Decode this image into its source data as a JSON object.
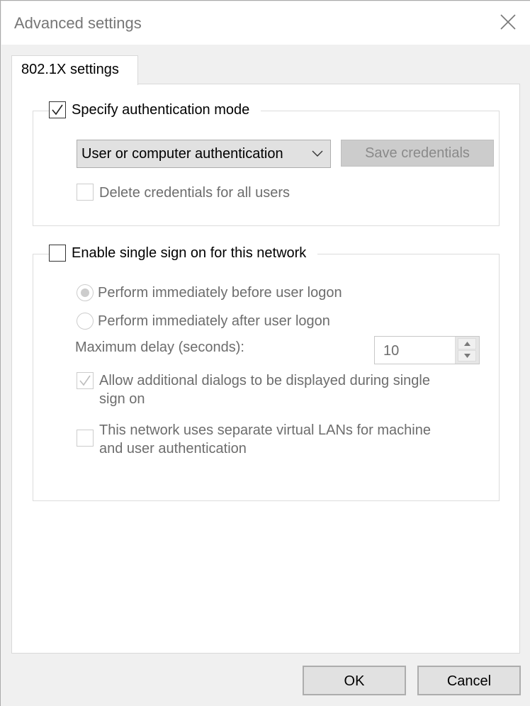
{
  "window": {
    "title": "Advanced settings",
    "close_icon": "close-icon"
  },
  "tabs": [
    {
      "label": "802.1X settings",
      "active": true
    }
  ],
  "auth_group": {
    "specify_mode": {
      "label": "Specify authentication mode",
      "checked": true
    },
    "mode_select": {
      "value": "User or computer authentication",
      "icon": "chevron-down-icon"
    },
    "save_credentials": {
      "label": "Save credentials",
      "enabled": false
    },
    "delete_credentials": {
      "label": "Delete credentials for all users",
      "checked": false,
      "enabled": false
    }
  },
  "sso_group": {
    "enable_sso": {
      "label": "Enable single sign on for this network",
      "checked": false
    },
    "radio_before": {
      "label": "Perform immediately before user logon",
      "selected": true,
      "enabled": false
    },
    "radio_after": {
      "label": "Perform immediately after user logon",
      "selected": false,
      "enabled": false
    },
    "max_delay": {
      "label": "Maximum delay (seconds):",
      "value": "10"
    },
    "allow_dialogs": {
      "label_line1": "Allow additional dialogs to be displayed during single",
      "label_line2": "sign on",
      "checked": true,
      "enabled": false
    },
    "separate_vlans": {
      "label_line1": "This network uses separate virtual LANs for machine",
      "label_line2": "and user authentication",
      "checked": false,
      "enabled": false
    }
  },
  "footer": {
    "ok_label": "OK",
    "cancel_label": "Cancel"
  }
}
